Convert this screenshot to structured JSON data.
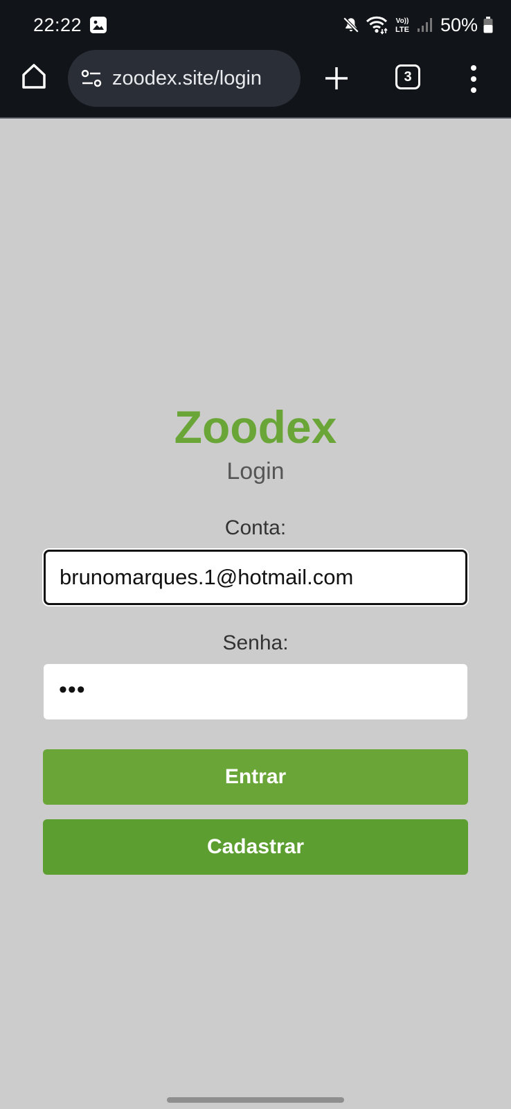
{
  "status_bar": {
    "time": "22:22",
    "battery": "50%",
    "icons": [
      "image-icon",
      "mute-icon",
      "wifi-icon",
      "volte-icon",
      "signal-icon",
      "battery-icon"
    ],
    "volte_top": "Vo))",
    "volte_bottom": "LTE"
  },
  "browser": {
    "url": "zoodex.site/login",
    "tab_count": "3",
    "icons": [
      "home-icon",
      "site-settings-icon",
      "plus-icon",
      "tabs-icon",
      "more-vert-icon"
    ]
  },
  "page": {
    "title": "Zoodex",
    "subtitle": "Login",
    "account_label": "Conta:",
    "account_value": "brunomarques.1@hotmail.com",
    "password_label": "Senha:",
    "password_value": "•••",
    "login_button": "Entrar",
    "register_button": "Cadastrar"
  },
  "colors": {
    "brand_green": "#6aa637",
    "button_green_dark": "#5c9e2f",
    "page_background": "#cccccc",
    "chrome_background": "#111418"
  }
}
